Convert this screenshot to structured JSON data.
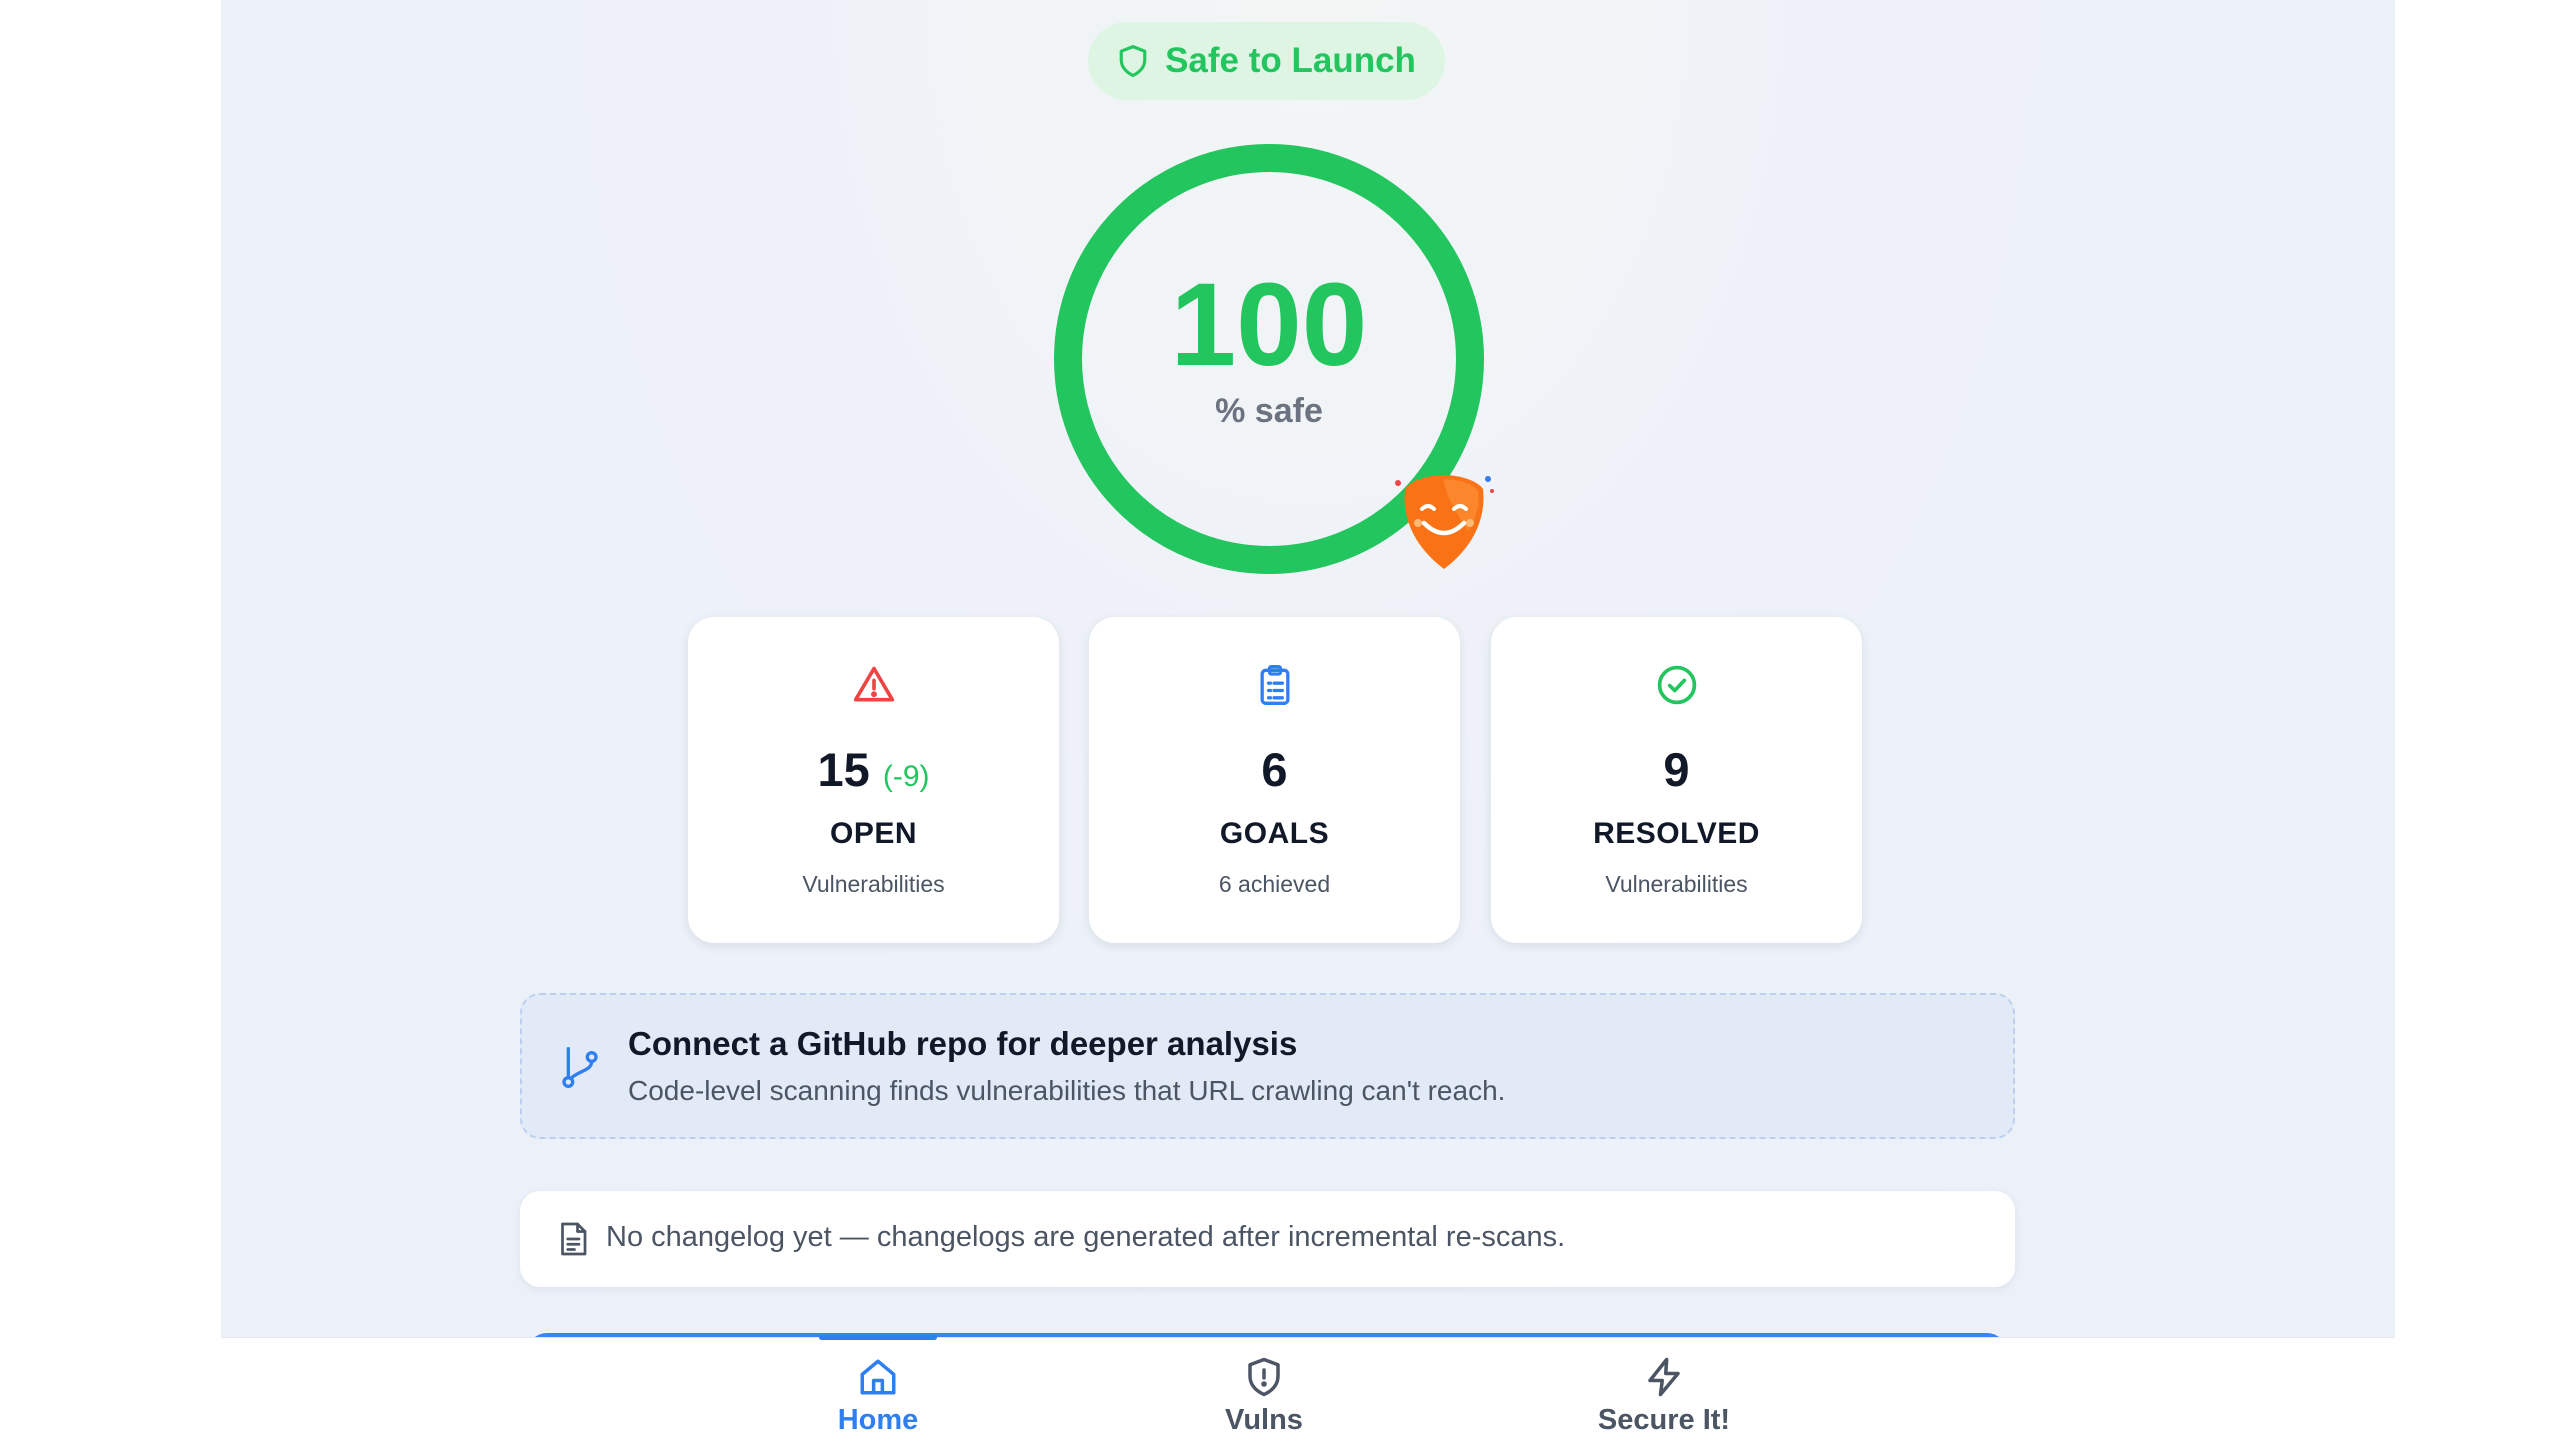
{
  "status": {
    "label": "Safe to Launch",
    "color": "#22c55e",
    "icon": "shield-icon"
  },
  "score": {
    "value": "100",
    "label": "% safe",
    "percent": 100
  },
  "mascot": {
    "icon": "smiling-shield-mascot"
  },
  "stats": [
    {
      "icon": "warning-triangle-icon",
      "value": "15",
      "delta": "(-9)",
      "title": "OPEN",
      "subtitle": "Vulnerabilities"
    },
    {
      "icon": "clipboard-list-icon",
      "value": "6",
      "delta": "",
      "title": "GOALS",
      "subtitle": "6 achieved"
    },
    {
      "icon": "check-circle-icon",
      "value": "9",
      "delta": "",
      "title": "RESOLVED",
      "subtitle": "Vulnerabilities"
    }
  ],
  "github": {
    "icon": "git-branch-icon",
    "title": "Connect a GitHub repo for deeper analysis",
    "description": "Code-level scanning finds vulnerabilities that URL crawling can't reach."
  },
  "changelog": {
    "icon": "document-icon",
    "text": "No changelog yet — changelogs are generated after incremental re-scans."
  },
  "nav": {
    "items": [
      {
        "icon": "home-icon",
        "label": "Home",
        "active": true
      },
      {
        "icon": "shield-alert-icon",
        "label": "Vulns",
        "active": false
      },
      {
        "icon": "lightning-bolt-icon",
        "label": "Secure It!",
        "active": false
      }
    ]
  },
  "colors": {
    "success": "#22c55e",
    "danger": "#ef4444",
    "primary": "#2f7ff0",
    "mascot": "#f97316"
  }
}
